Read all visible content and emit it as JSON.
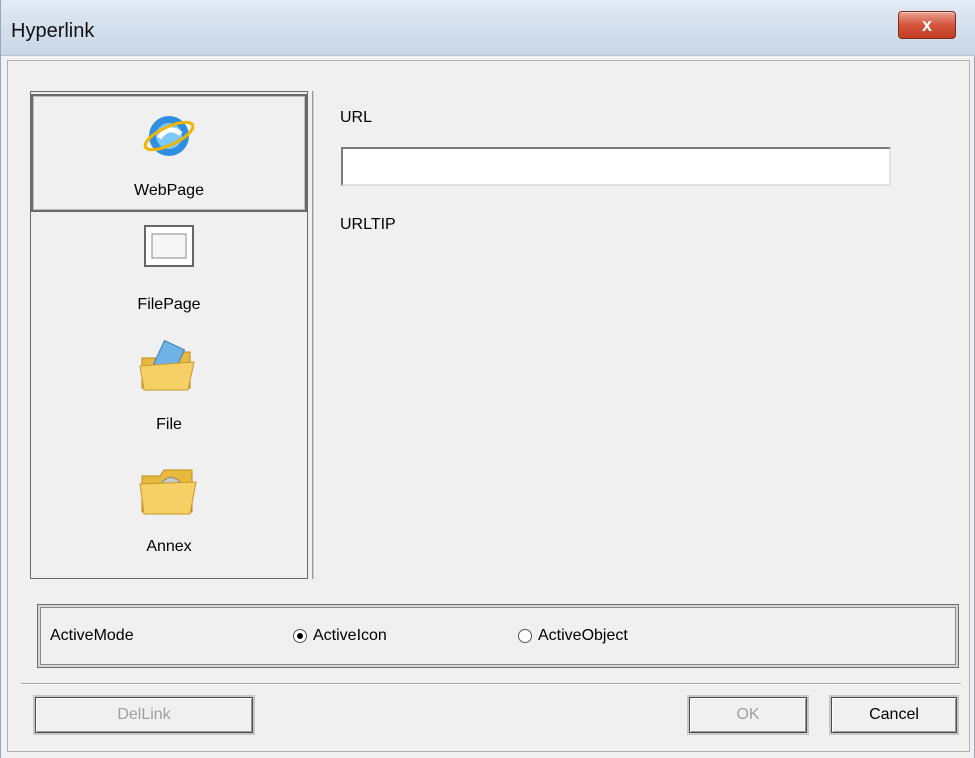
{
  "window": {
    "title": "Hyperlink",
    "close_label": "x"
  },
  "nav": {
    "items": [
      {
        "label": "WebPage",
        "icon": "globe-ie-icon",
        "selected": true
      },
      {
        "label": "FilePage",
        "icon": "window-page-icon",
        "selected": false
      },
      {
        "label": "File",
        "icon": "folder-file-icon",
        "selected": false
      },
      {
        "label": "Annex",
        "icon": "folder-annex-icon",
        "selected": false
      }
    ]
  },
  "content": {
    "url_label": "URL",
    "url_value": "",
    "urltip_label": "URLTIP"
  },
  "mode": {
    "label": "ActiveMode",
    "options": [
      {
        "label": "ActiveIcon",
        "checked": true
      },
      {
        "label": "ActiveObject",
        "checked": false
      }
    ]
  },
  "buttons": {
    "dellink": "DelLink",
    "ok": "OK",
    "cancel": "Cancel"
  },
  "colors": {
    "titlebar": "#d2deec",
    "close": "#d5543c",
    "background": "#f0f0f0"
  }
}
